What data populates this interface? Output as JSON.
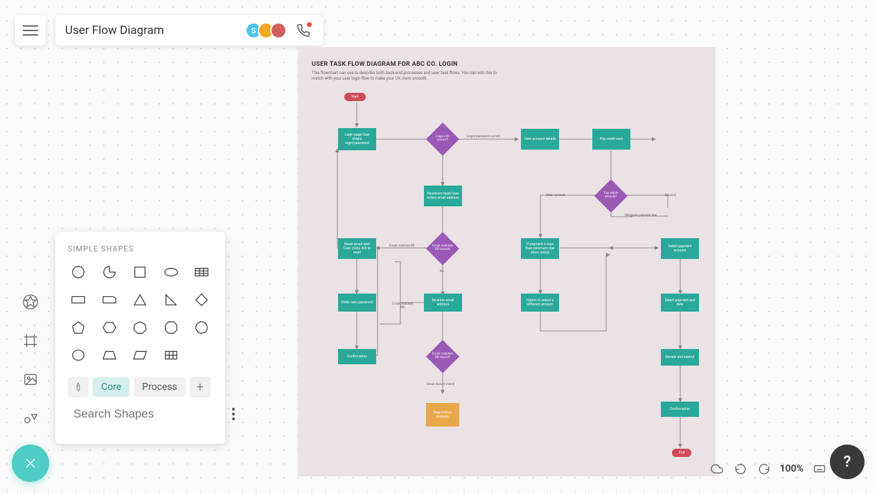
{
  "header": {
    "title": "User Flow Diagram",
    "avatar_initial": "S"
  },
  "panel": {
    "section_title": "SIMPLE SHAPES",
    "tabs": {
      "core": "Core",
      "process": "Process"
    },
    "search_placeholder": "Search Shapes"
  },
  "canvas": {
    "title": "USER TASK FLOW DIAGRAM FOR ABC CO. LOGIN",
    "subtitle": "This flowchart can use to describe both back-end processes and user task flows. You can edit this to match with your user login flow to make your UX more smooth",
    "start": "Start",
    "end": "End",
    "login_page": "Login page User enters login/password",
    "login_match": "Login info correct?",
    "login_correct": "Login/password correct",
    "view_account": "View account details",
    "pay_credit": "Pay credit card",
    "password_reset": "Password reset User enters email address",
    "email_matches": "Email matches DB records",
    "email_matches_lbl": "Email matches DB",
    "reset_email": "Reset email sent User clicks link to reset",
    "no_lbl": "No",
    "reenter_email": "Re-enter email address",
    "enter_new_pw": "Enter new password",
    "email_matches2_lbl": "Email matches DB",
    "email_matches2": "Email matches DB record?",
    "confirmation": "Confirmation",
    "nomatch_lbl": "Email doesn't match",
    "registration": "Registration process",
    "pay_which": "Pay which amount?",
    "other_amount": "Other amount",
    "balance_lbl": "Balance",
    "min_pay_lbl": "Minimum payment due",
    "payment_less": "If payment is less than minimum due show notice",
    "select_payment": "Select payment account",
    "option_select": "Option to select a different amount",
    "select_date": "Select payment and date",
    "review_submit": "Review and submit",
    "confirmation2": "Confirmation"
  },
  "footer": {
    "zoom": "100%"
  }
}
